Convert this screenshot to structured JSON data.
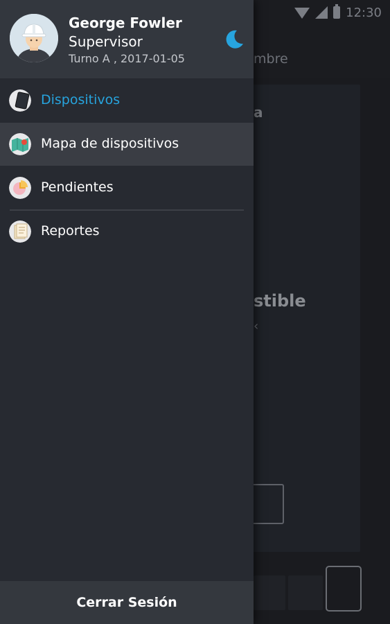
{
  "status_bar": {
    "time": "12:30"
  },
  "user": {
    "name": "George Fowler",
    "role": "Supervisor",
    "shift": "Turno A , 2017-01-05"
  },
  "menu": {
    "items": [
      {
        "label": "Dispositivos",
        "icon": "tablet-icon",
        "selected": true
      },
      {
        "label": "Mapa de dispositivos",
        "icon": "map-icon",
        "selected": false
      },
      {
        "label": "Pendientes",
        "icon": "pie-chart-icon",
        "selected": false
      },
      {
        "label": "Reportes",
        "icon": "report-icon",
        "selected": false
      }
    ]
  },
  "logout": {
    "label": "Cerrar Sesión"
  },
  "background": {
    "tab_fragment": "mbre",
    "card_title_fragment": "a",
    "card_heading_fragment": "stible",
    "card_mark_fragment": "‹"
  },
  "colors": {
    "accent": "#27a4de",
    "drawer_bg": "#272a31",
    "header_bg": "#33373e",
    "selected_row_bg": "#3a3d44"
  }
}
